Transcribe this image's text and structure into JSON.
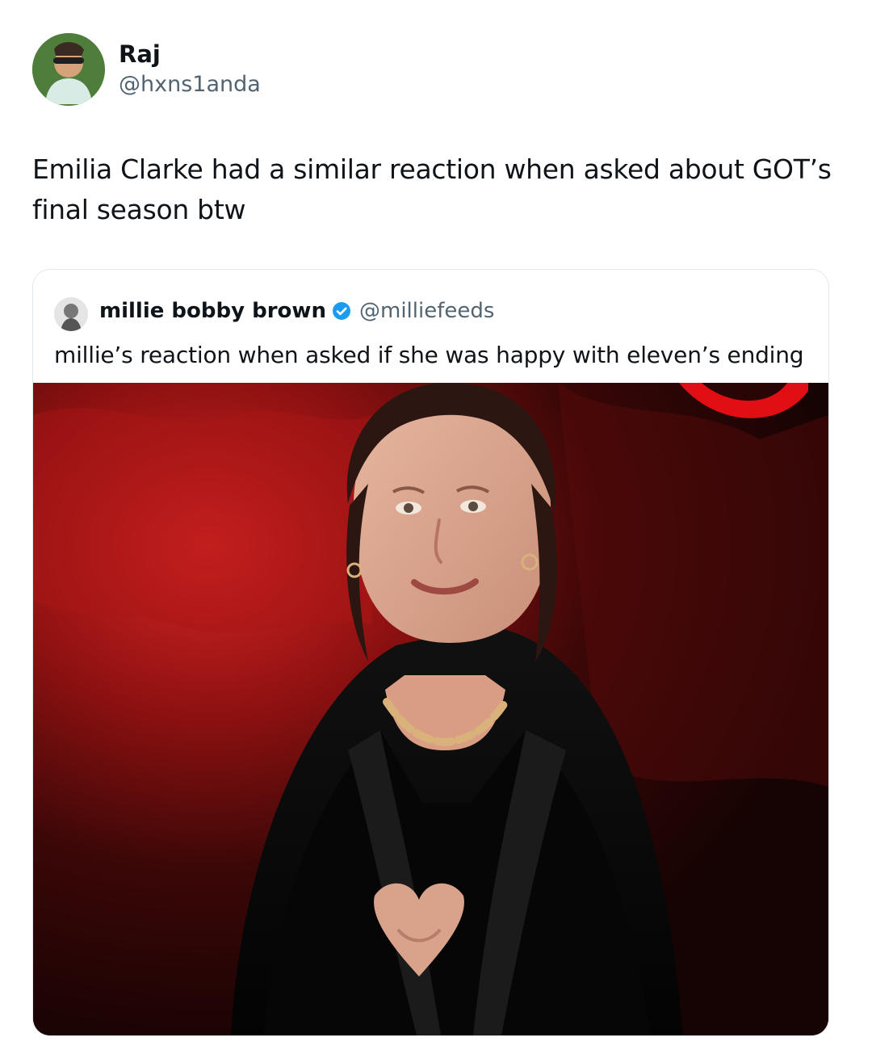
{
  "tweet": {
    "author_name": "Raj",
    "author_handle": "@hxns1anda",
    "text": "Emilia Clarke had a similar reaction when asked about GOT’s final season btw",
    "avatar_icon": "profile-photo"
  },
  "quoted_tweet": {
    "author_name": "millie bobby brown",
    "author_handle": "@milliefeeds",
    "verified": true,
    "verified_icon": "verified-badge-icon",
    "text": "millie’s reaction when asked if she was happy with eleven’s ending",
    "avatar_icon": "profile-photo",
    "media_icon": "video-still-image"
  },
  "colors": {
    "text_primary": "#0f1419",
    "text_secondary": "#536471",
    "border": "#e1e8ed",
    "verified_blue": "#1d9bf0"
  }
}
